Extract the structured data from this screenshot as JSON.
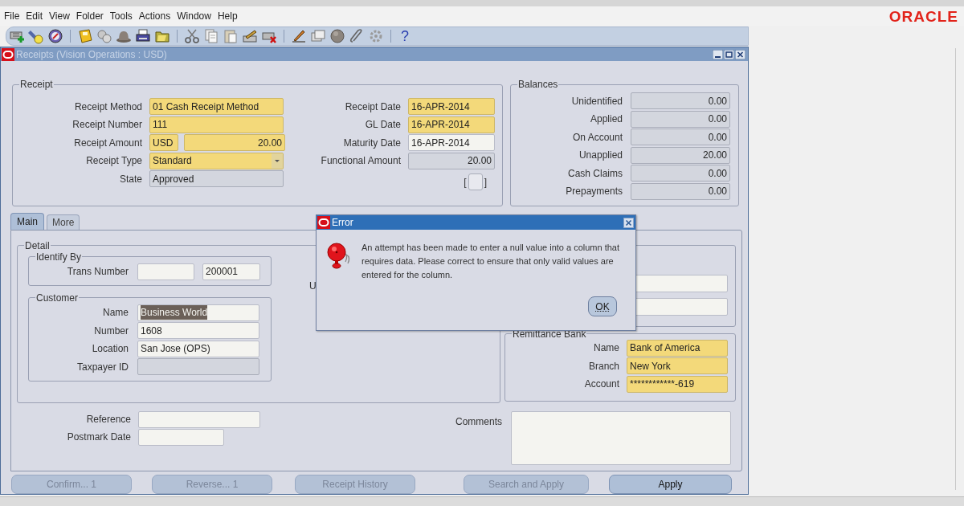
{
  "menu": [
    {
      "label": "File"
    },
    {
      "label": "Edit"
    },
    {
      "label": "View"
    },
    {
      "label": "Folder"
    },
    {
      "label": "Tools"
    },
    {
      "label": "Actions"
    },
    {
      "label": "Window"
    },
    {
      "label": "Help"
    }
  ],
  "logo": "ORACLE",
  "toolbar": {
    "help_glyph": "?"
  },
  "window": {
    "title": "Receipts (Vision Operations : USD)"
  },
  "receipt": {
    "legend": "Receipt",
    "left": [
      {
        "label": "Receipt Method",
        "fields": [
          {
            "value": "01 Cash Receipt Method",
            "kind": "required"
          }
        ]
      },
      {
        "label": "Receipt Number",
        "fields": [
          {
            "value": "111",
            "kind": "required"
          }
        ]
      },
      {
        "label": "Receipt Amount",
        "fields": [
          {
            "value": "USD",
            "kind": "required"
          },
          {
            "value": "20.00",
            "kind": "required",
            "numeric": true
          }
        ]
      },
      {
        "label": "Receipt Type",
        "fields": [
          {
            "value": "Standard",
            "kind": "required",
            "dropdown": true
          }
        ]
      },
      {
        "label": "State",
        "fields": [
          {
            "value": "Approved",
            "kind": "readonly"
          }
        ]
      }
    ],
    "right": [
      {
        "label": "Receipt Date",
        "fields": [
          {
            "value": "16-APR-2014",
            "kind": "required"
          }
        ]
      },
      {
        "label": "GL Date",
        "fields": [
          {
            "value": "16-APR-2014",
            "kind": "required"
          }
        ]
      },
      {
        "label": "Maturity Date",
        "fields": [
          {
            "value": "16-APR-2014",
            "kind": "optional"
          }
        ]
      },
      {
        "label": "Functional Amount",
        "fields": [
          {
            "value": "20.00",
            "kind": "readonly",
            "numeric": true
          }
        ]
      }
    ],
    "flexfield": {
      "open": "[",
      "close": "]"
    }
  },
  "balances": {
    "legend": "Balances",
    "rows": [
      {
        "label": "Unidentified",
        "fields": [
          {
            "value": "0.00",
            "kind": "readonly",
            "numeric": true
          }
        ]
      },
      {
        "label": "Applied",
        "fields": [
          {
            "value": "0.00",
            "kind": "readonly",
            "numeric": true
          }
        ]
      },
      {
        "label": "On Account",
        "fields": [
          {
            "value": "0.00",
            "kind": "readonly",
            "numeric": true
          }
        ]
      },
      {
        "label": "Unapplied",
        "fields": [
          {
            "value": "20.00",
            "kind": "readonly",
            "numeric": true
          }
        ]
      },
      {
        "label": "Cash Claims",
        "fields": [
          {
            "value": "0.00",
            "kind": "readonly",
            "numeric": true
          }
        ]
      },
      {
        "label": "Prepayments",
        "fields": [
          {
            "value": "0.00",
            "kind": "readonly",
            "numeric": true
          }
        ]
      }
    ]
  },
  "tabs": [
    {
      "label": "Main",
      "selected": true
    },
    {
      "label": "More",
      "selected": false
    }
  ],
  "detail": {
    "legend": "Detail",
    "identify_by": {
      "legend": "Identify By",
      "rows": [
        {
          "label": "Trans Number",
          "fields": [
            {
              "kind": "optional"
            },
            {
              "value": "200001",
              "kind": "optional"
            }
          ]
        }
      ]
    },
    "customer": {
      "legend": "Customer",
      "rows": [
        {
          "label": "Name",
          "fields": [
            {
              "value": "Business World",
              "kind": "optional",
              "highlighted": true
            }
          ]
        },
        {
          "label": "Number",
          "fields": [
            {
              "value": "1608",
              "kind": "optional"
            }
          ]
        },
        {
          "label": "Location",
          "fields": [
            {
              "value": "San Jose (OPS)",
              "kind": "optional"
            }
          ]
        },
        {
          "label": "Taxpayer ID",
          "fields": [
            {
              "kind": "readonly"
            }
          ]
        }
      ]
    },
    "partial_label": "U"
  },
  "remittance_bank": {
    "legend": "Remittance Bank",
    "rows": [
      {
        "label": "Name",
        "fields": [
          {
            "value": "Bank of America",
            "kind": "required"
          }
        ]
      },
      {
        "label": "Branch",
        "fields": [
          {
            "value": "New York",
            "kind": "required"
          }
        ]
      },
      {
        "label": "Account",
        "fields": [
          {
            "value": "************-619",
            "kind": "required"
          }
        ]
      }
    ]
  },
  "references": [
    {
      "label": "Reference",
      "fields": [
        {
          "kind": "optional"
        }
      ]
    },
    {
      "label": "Postmark Date",
      "fields": [
        {
          "kind": "optional"
        }
      ]
    }
  ],
  "comments": {
    "label": "Comments"
  },
  "buttons": [
    {
      "label": "Confirm... 1",
      "disabled": true
    },
    {
      "label": "Reverse... 1",
      "disabled": true
    },
    {
      "label": "Receipt History",
      "disabled": true
    },
    {
      "label": "Search and Apply",
      "disabled": true
    },
    {
      "label": "Apply",
      "disabled": false
    }
  ],
  "dialog": {
    "title": "Error",
    "message": "An attempt has been made to enter a null value into a column that requires data. Please correct to ensure that only valid values are entered for the column.",
    "button": "OK"
  }
}
